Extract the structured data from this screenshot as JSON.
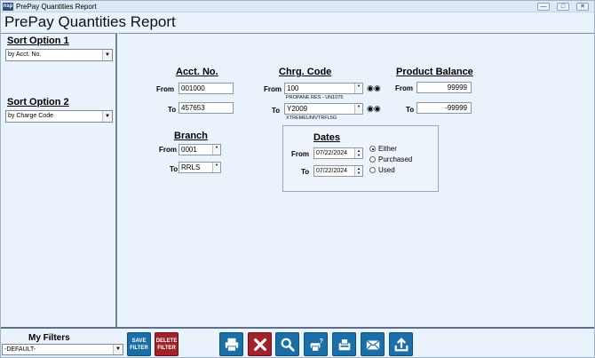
{
  "window": {
    "title": "PrePay Quantities Report",
    "app_icon": "nsp"
  },
  "page": {
    "title": "PrePay Quantities Report"
  },
  "sort": {
    "option1_label": "Sort Option 1",
    "option1_value": "by Acct. No.",
    "option2_label": "Sort Option 2",
    "option2_value": "by Charge Code"
  },
  "acct": {
    "header": "Acct. No.",
    "from_label": "From",
    "from_value": "001000",
    "to_label": "To",
    "to_value": "457653"
  },
  "chrg": {
    "header": "Chrg. Code",
    "from_label": "From",
    "from_value": "100",
    "from_desc": "PROPANE RES - UN1075",
    "to_label": "To",
    "to_value": "Y2009",
    "to_desc": "XTREMEUNIVTRFL5G"
  },
  "balance": {
    "header": "Product Balance",
    "from_label": "From",
    "from_value": "99999",
    "to_label": "To",
    "to_value": "-99999"
  },
  "branch": {
    "header": "Branch",
    "from_label": "From",
    "from_value": "0001",
    "to_label": "To",
    "to_value": "RRLS"
  },
  "dates": {
    "header": "Dates",
    "from_label": "From",
    "from_value": "07/22/2024",
    "to_label": "To",
    "to_value": "07/22/2024",
    "options": [
      "Either",
      "Purchased",
      "Used"
    ],
    "selected": "Either"
  },
  "filters": {
    "label": "My Filters",
    "value": "-DEFAULT-",
    "save_label_1": "SAVE",
    "save_label_2": "FILTER",
    "delete_label_1": "DELETE",
    "delete_label_2": "FILTER"
  },
  "toolbar_icons": [
    "print-icon",
    "cancel-icon",
    "preview-icon",
    "print-setup-icon",
    "fax-icon",
    "email-icon",
    "export-icon"
  ],
  "colors": {
    "button_blue": "#1b6fa8",
    "button_red": "#a3222a"
  }
}
